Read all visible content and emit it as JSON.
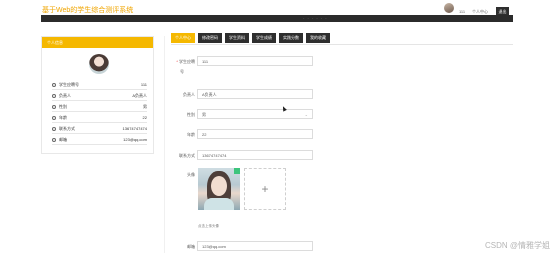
{
  "header": {
    "site_title": "基于Web的学生综合测评系统",
    "user_name": "111",
    "personal_center": "个人中心",
    "logout": "退出",
    "band_text": "- - - - - -"
  },
  "left_card": {
    "title": "个人信息",
    "rows": [
      {
        "label": "学生应聘号",
        "value": "111"
      },
      {
        "label": "负责人",
        "value": "A负责人"
      },
      {
        "label": "性别",
        "value": "男"
      },
      {
        "label": "年龄",
        "value": "22"
      },
      {
        "label": "联系方式",
        "value": "13674747474"
      },
      {
        "label": "邮箱",
        "value": "123@qq.com"
      }
    ]
  },
  "tabs": [
    {
      "label": "个人中心",
      "active": true
    },
    {
      "label": "修改密码",
      "active": false
    },
    {
      "label": "学生资料",
      "active": false
    },
    {
      "label": "学生成绩",
      "active": false
    },
    {
      "label": "实践分数",
      "active": false
    },
    {
      "label": "我的收藏",
      "active": false
    }
  ],
  "form": {
    "student_no_label": "学生应聘",
    "student_no_label_2": "号",
    "student_no_value": "111",
    "manager_label": "负责人",
    "manager_value": "A负责人",
    "gender_label": "性别",
    "gender_value": "男",
    "gender_arrow": "⌄",
    "age_label": "年龄",
    "age_value": "22",
    "phone_label": "联系方式",
    "phone_value": "13674747474",
    "avatar_label": "头像",
    "upload_plus": "+",
    "upload_tip": "点击上传头像",
    "email_label": "邮箱",
    "email_value": "123@qq.com"
  },
  "watermark": "CSDN @情雅学姐",
  "colors": {
    "accent": "#f5b800",
    "dark": "#2e2e2e",
    "title": "#f0a500"
  }
}
